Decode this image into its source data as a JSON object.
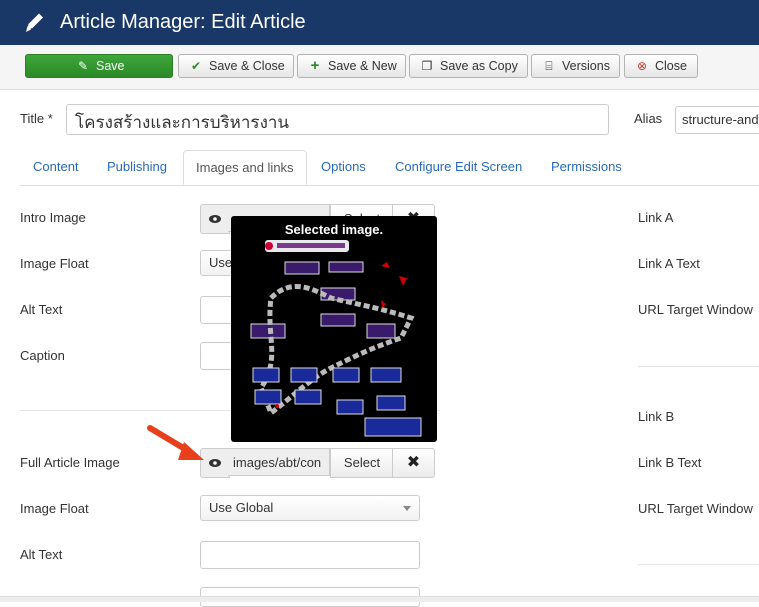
{
  "header": {
    "title": "Article Manager: Edit Article",
    "icon": "pencil-icon"
  },
  "toolbar": {
    "save": "Save",
    "save_close": "Save & Close",
    "save_new": "Save & New",
    "save_copy": "Save as Copy",
    "versions": "Versions",
    "close": "Close"
  },
  "title_field": {
    "label": "Title *",
    "value": "โครงสร้างและการบริหารงาน"
  },
  "alias_field": {
    "label": "Alias",
    "value": "structure-and"
  },
  "tabs": [
    "Content",
    "Publishing",
    "Images and links",
    "Options",
    "Configure Edit Screen",
    "Permissions"
  ],
  "intro": {
    "image_label": "Intro Image",
    "select_label": "Select",
    "float_label": "Image Float",
    "float_value": "Use",
    "alt_label": "Alt Text",
    "caption_label": "Caption"
  },
  "full": {
    "image_label": "Full Article Image",
    "path_value": "images/abt/con",
    "select_label": "Select",
    "float_label": "Image Float",
    "float_value": "Use Global",
    "alt_label": "Alt Text"
  },
  "links": {
    "link_a": "Link A",
    "link_a_text": "Link A Text",
    "url_target_a": "URL Target Window",
    "link_b": "Link B",
    "link_b_text": "Link B Text",
    "url_target_b": "URL Target Window"
  },
  "tooltip": {
    "title": "Selected image."
  },
  "colors": {
    "header_bg": "#1a3867",
    "save_green": "#2c8a28",
    "link_blue": "#2a69b8",
    "arrow_red": "#e8401c"
  }
}
